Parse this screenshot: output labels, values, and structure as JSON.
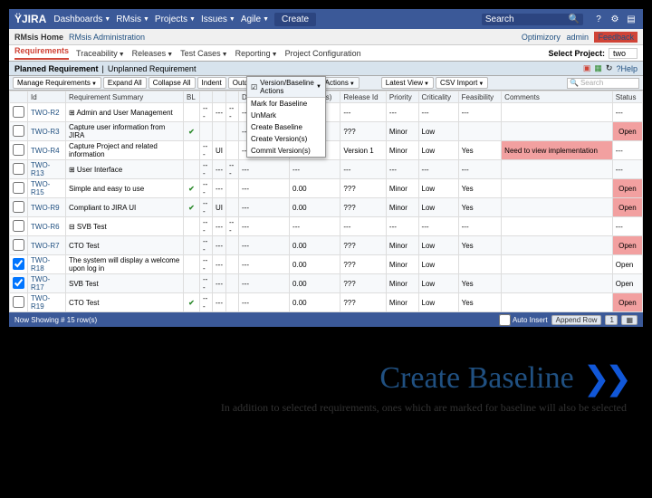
{
  "topbar": {
    "logo": "ŸJIRA",
    "nav": [
      "Dashboards",
      "RMsis",
      "Projects",
      "Issues",
      "Agile"
    ],
    "create": "Create",
    "search_label": "Search"
  },
  "subbar": {
    "home": "RMsis Home",
    "admin": "RMsis Administration",
    "right": {
      "opt": "Optimizory",
      "admin": "admin",
      "feedback": "Feedback"
    }
  },
  "tabs": [
    "Requirements",
    "Traceability",
    "Releases",
    "Test Cases",
    "Reporting",
    "Project Configuration"
  ],
  "select_project": {
    "label": "Select Project:",
    "value": "two"
  },
  "reqbar": {
    "planned": "Planned Requirement",
    "unplanned": "Unplanned Requirement",
    "help": "Help"
  },
  "toolbar": {
    "manage": "Manage Requirements",
    "expand": "Expand All",
    "collapse": "Collapse All",
    "indent": "Indent",
    "outdent": "Outdent",
    "version": "Version/Baseline Actions",
    "latest": "Latest View",
    "csv": "CSV Import",
    "search": "Search"
  },
  "dropdown": {
    "head": "Version/Baseline Actions",
    "items": [
      "Mark for Baseline",
      "UnMark",
      "Create Baseline",
      "Create Version(s)",
      "Commit Version(s)"
    ]
  },
  "columns": [
    "",
    "Id",
    "Requirement Summary",
    "BL",
    "",
    "",
    "",
    "Dependents",
    "Effort (days)",
    "Release Id",
    "Priority",
    "Criticality",
    "Feasibility",
    "Comments",
    "Status"
  ],
  "rows": [
    {
      "chk": false,
      "id": "TWO-R2",
      "sum": "⊞ Admin and User Management",
      "bl": "",
      "c1": "---",
      "c2": "---",
      "c3": "---",
      "dep": "---",
      "eff": "---",
      "rel": "---",
      "pri": "---",
      "crit": "---",
      "feas": "---",
      "com": "",
      "status": "---"
    },
    {
      "chk": false,
      "id": "TWO-R3",
      "sum": "Capture user information from JIRA",
      "bl": "✔",
      "c1": "",
      "c2": "",
      "c3": "",
      "dep": "---",
      "eff": "0.00",
      "rel": "???",
      "pri": "Minor",
      "crit": "Low",
      "feas": "",
      "com": "",
      "status": "Open",
      "open": true
    },
    {
      "chk": false,
      "id": "TWO-R4",
      "sum": "Capture Project and related information",
      "bl": "",
      "c1": "---",
      "c2": "UI",
      "c3": "",
      "dep": "---",
      "eff": "0.00",
      "rel": "Version 1",
      "pri": "Minor",
      "crit": "Low",
      "feas": "Yes",
      "com": "Need to view implementation",
      "com_hl": true,
      "status": "---"
    },
    {
      "chk": false,
      "id": "TWO-R13",
      "sum": "⊞ User Interface",
      "bl": "",
      "c1": "---",
      "c2": "---",
      "c3": "---",
      "dep": "---",
      "eff": "---",
      "rel": "---",
      "pri": "---",
      "crit": "---",
      "feas": "---",
      "com": "",
      "status": "---"
    },
    {
      "chk": false,
      "id": "TWO-R15",
      "sum": "Simple and easy to use",
      "bl": "✔",
      "c1": "---",
      "c2": "---",
      "c3": "",
      "dep": "---",
      "eff": "0.00",
      "rel": "???",
      "pri": "Minor",
      "crit": "Low",
      "feas": "Yes",
      "com": "",
      "status": "Open",
      "open": true
    },
    {
      "chk": false,
      "id": "TWO-R9",
      "sum": "Compliant to JIRA UI",
      "bl": "✔",
      "c1": "---",
      "c2": "UI",
      "c3": "",
      "dep": "---",
      "eff": "0.00",
      "rel": "???",
      "pri": "Minor",
      "crit": "Low",
      "feas": "Yes",
      "com": "",
      "status": "Open",
      "open": true
    },
    {
      "chk": false,
      "id": "TWO-R6",
      "sum": "⊟ SVB Test",
      "bl": "",
      "c1": "---",
      "c2": "---",
      "c3": "---",
      "dep": "---",
      "eff": "---",
      "rel": "---",
      "pri": "---",
      "crit": "---",
      "feas": "---",
      "com": "",
      "status": "---"
    },
    {
      "chk": false,
      "id": "TWO-R7",
      "sum": "CTO Test",
      "bl": "",
      "c1": "---",
      "c2": "---",
      "c3": "",
      "dep": "---",
      "eff": "0.00",
      "rel": "???",
      "pri": "Minor",
      "crit": "Low",
      "feas": "Yes",
      "com": "",
      "status": "Open",
      "open": true
    },
    {
      "chk": true,
      "id": "TWO-R18",
      "sum": "The system will display a welcome upon log in",
      "bl": "",
      "c1": "---",
      "c2": "---",
      "c3": "",
      "dep": "---",
      "eff": "0.00",
      "rel": "???",
      "pri": "Minor",
      "crit": "Low",
      "feas": "",
      "com": "",
      "status": "Open"
    },
    {
      "chk": true,
      "id": "TWO-R17",
      "sum": "SVB Test",
      "bl": "",
      "c1": "---",
      "c2": "---",
      "c3": "",
      "dep": "---",
      "eff": "0.00",
      "rel": "???",
      "pri": "Minor",
      "crit": "Low",
      "feas": "Yes",
      "com": "",
      "status": "Open"
    },
    {
      "chk": false,
      "id": "TWO-R19",
      "sum": "CTO Test",
      "bl": "✔",
      "c1": "---",
      "c2": "---",
      "c3": "",
      "dep": "---",
      "eff": "0.00",
      "rel": "???",
      "pri": "Minor",
      "crit": "Low",
      "feas": "Yes",
      "com": "",
      "status": "Open",
      "open": true
    }
  ],
  "footer": {
    "showing": "Now Showing # 15 row(s)",
    "auto": "Auto Insert",
    "append": "Append Row",
    "page": "1"
  },
  "slide": {
    "title": "Create Baseline",
    "sub": "In addition to selected requirements, ones which are marked for baseline will also be selected"
  }
}
